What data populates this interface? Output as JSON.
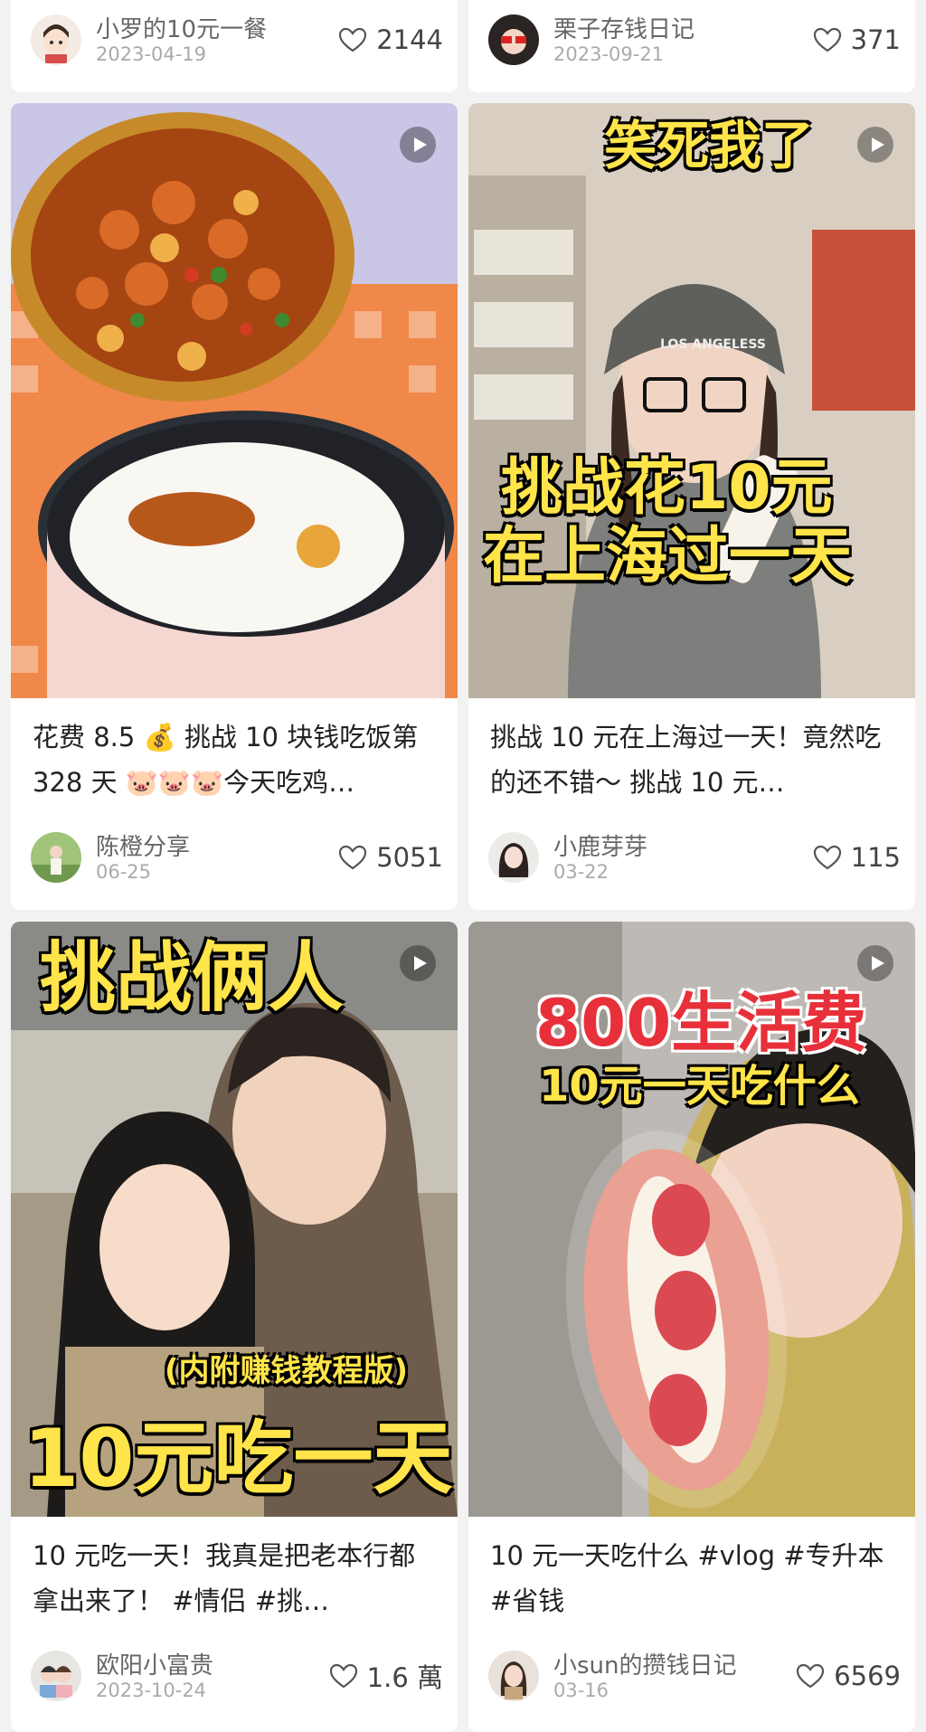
{
  "cards": {
    "left_top": {
      "author": "小罗的10元一餐",
      "date": "2023-04-19",
      "likes": "2144"
    },
    "right_top": {
      "author": "栗子存钱日记",
      "date": "2023-09-21",
      "likes": "371"
    },
    "left_1": {
      "title": "花费 8.5 💰 挑战 10 块钱吃饭第 328 天 🐷🐷🐷今天吃鸡…",
      "author": "陈橙分享",
      "date": "06-25",
      "likes": "5051",
      "overlays": {}
    },
    "right_1": {
      "title": "挑战 10 元在上海过一天！竟然吃的还不错～ 挑战 10 元…",
      "author": "小鹿芽芽",
      "date": "03-22",
      "likes": "115",
      "overlays": {
        "top": "笑死我了",
        "line1": "挑战花10元",
        "line2": "在上海过一天",
        "cap": "LOS ANGELESS"
      }
    },
    "left_2": {
      "title": "10 元吃一天！我真是把老本行都拿出来了！ #情侣 #挑…",
      "author": "欧阳小富贵",
      "date": "2023-10-24",
      "likes": "1.6 萬",
      "overlays": {
        "top": "挑战俩人",
        "sub": "(内附赚钱教程版)",
        "bottom": "10元吃一天"
      }
    },
    "right_2": {
      "title": "10 元一天吃什么 #vlog #专升本 #省钱",
      "author": "小sun的攒钱日记",
      "date": "03-16",
      "likes": "6569",
      "overlays": {
        "line1": "800生活费",
        "line2": "10元一天吃什么"
      }
    }
  },
  "icons": {
    "heart": "heart-outline-icon",
    "play": "play-icon"
  },
  "colors": {
    "background": "#f2f2f2",
    "card": "#ffffff",
    "overlay_yellow": "#ffe44a",
    "overlay_red": "#e8303a"
  }
}
